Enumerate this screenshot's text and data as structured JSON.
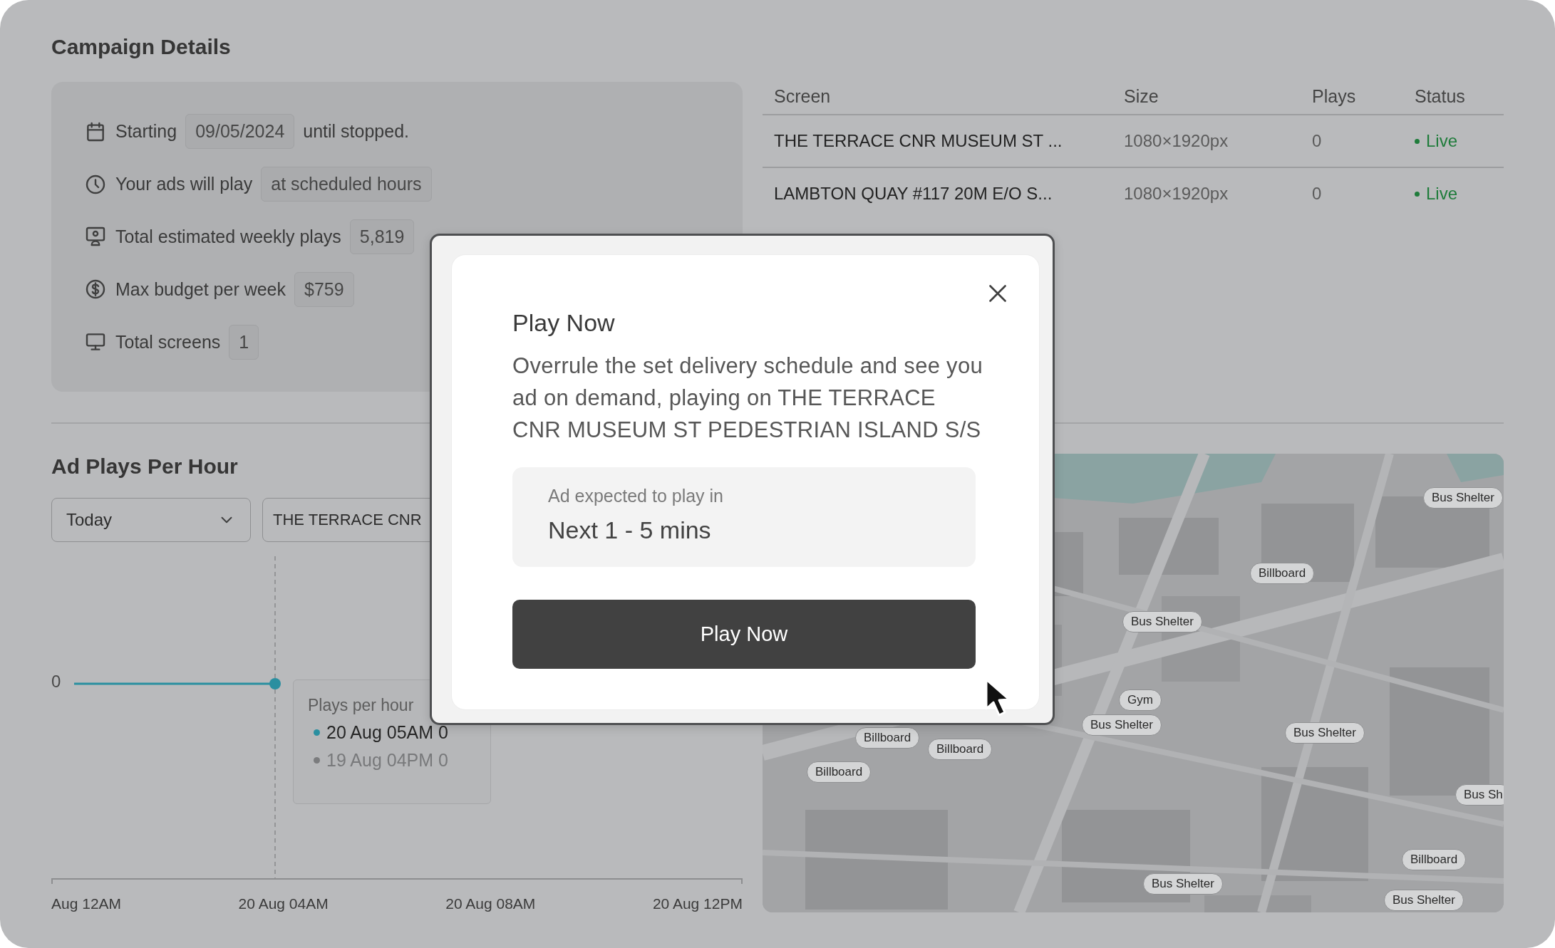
{
  "page_title": "Campaign Details",
  "details": [
    {
      "kind": "date",
      "label": "Starting",
      "value": "09/05/2024",
      "suffix": "until stopped."
    },
    {
      "kind": "schedule",
      "label": "Your ads will play",
      "value": "at scheduled hours"
    },
    {
      "kind": "plays",
      "label": "Total estimated weekly plays",
      "value": "5,819"
    },
    {
      "kind": "budget",
      "label": "Max budget per week",
      "value": "$759"
    },
    {
      "kind": "screens",
      "label": "Total screens",
      "value": "1"
    }
  ],
  "screens_table": {
    "columns": [
      "Screen",
      "Size",
      "Plays",
      "Status"
    ],
    "rows": [
      {
        "screen": "THE TERRACE CNR MUSEUM ST ...",
        "size": "1080×1920px",
        "plays": "0",
        "status": "Live"
      },
      {
        "screen": "LAMBTON QUAY #117 20M E/O S...",
        "size": "1080×1920px",
        "plays": "0",
        "status": "Live"
      }
    ]
  },
  "chart_section": {
    "title": "Ad Plays Per Hour",
    "period_select": "Today",
    "screen_select": "THE TERRACE CNR",
    "y_tick": "0",
    "x_ticks": [
      "Aug 12AM",
      "20 Aug 04AM",
      "20 Aug 08AM",
      "20 Aug 12PM"
    ],
    "tooltip": {
      "title": "Plays per hour",
      "entries": [
        {
          "text": "20 Aug 05AM 0",
          "color": "#2a8fa0"
        },
        {
          "text": "19 Aug 04PM 0",
          "color": "#7b7c7e"
        }
      ]
    }
  },
  "map": {
    "kind": "picture",
    "pins": [
      {
        "label": "Bus Shelter"
      },
      {
        "label": "Billboard"
      },
      {
        "label": "Bus Shelter"
      },
      {
        "label": "Gym"
      },
      {
        "label": "Bus Shelter"
      },
      {
        "label": "Bus Shelter"
      },
      {
        "label": "Billboard"
      },
      {
        "label": "Billboard"
      },
      {
        "label": "Billboard"
      },
      {
        "label": "Bus Sh"
      },
      {
        "label": "Billboard"
      },
      {
        "label": "Bus Shelter"
      },
      {
        "label": "Bus Shelter"
      }
    ]
  },
  "modal": {
    "title": "Play Now",
    "description": "Overrule the set delivery schedule and see you ad on demand, playing on THE TERRACE CNR MUSEUM ST PEDESTRIAN ISLAND S/S",
    "eta_label": "Ad expected to play in",
    "eta_value": "Next 1 - 5 mins",
    "button": "Play Now"
  }
}
